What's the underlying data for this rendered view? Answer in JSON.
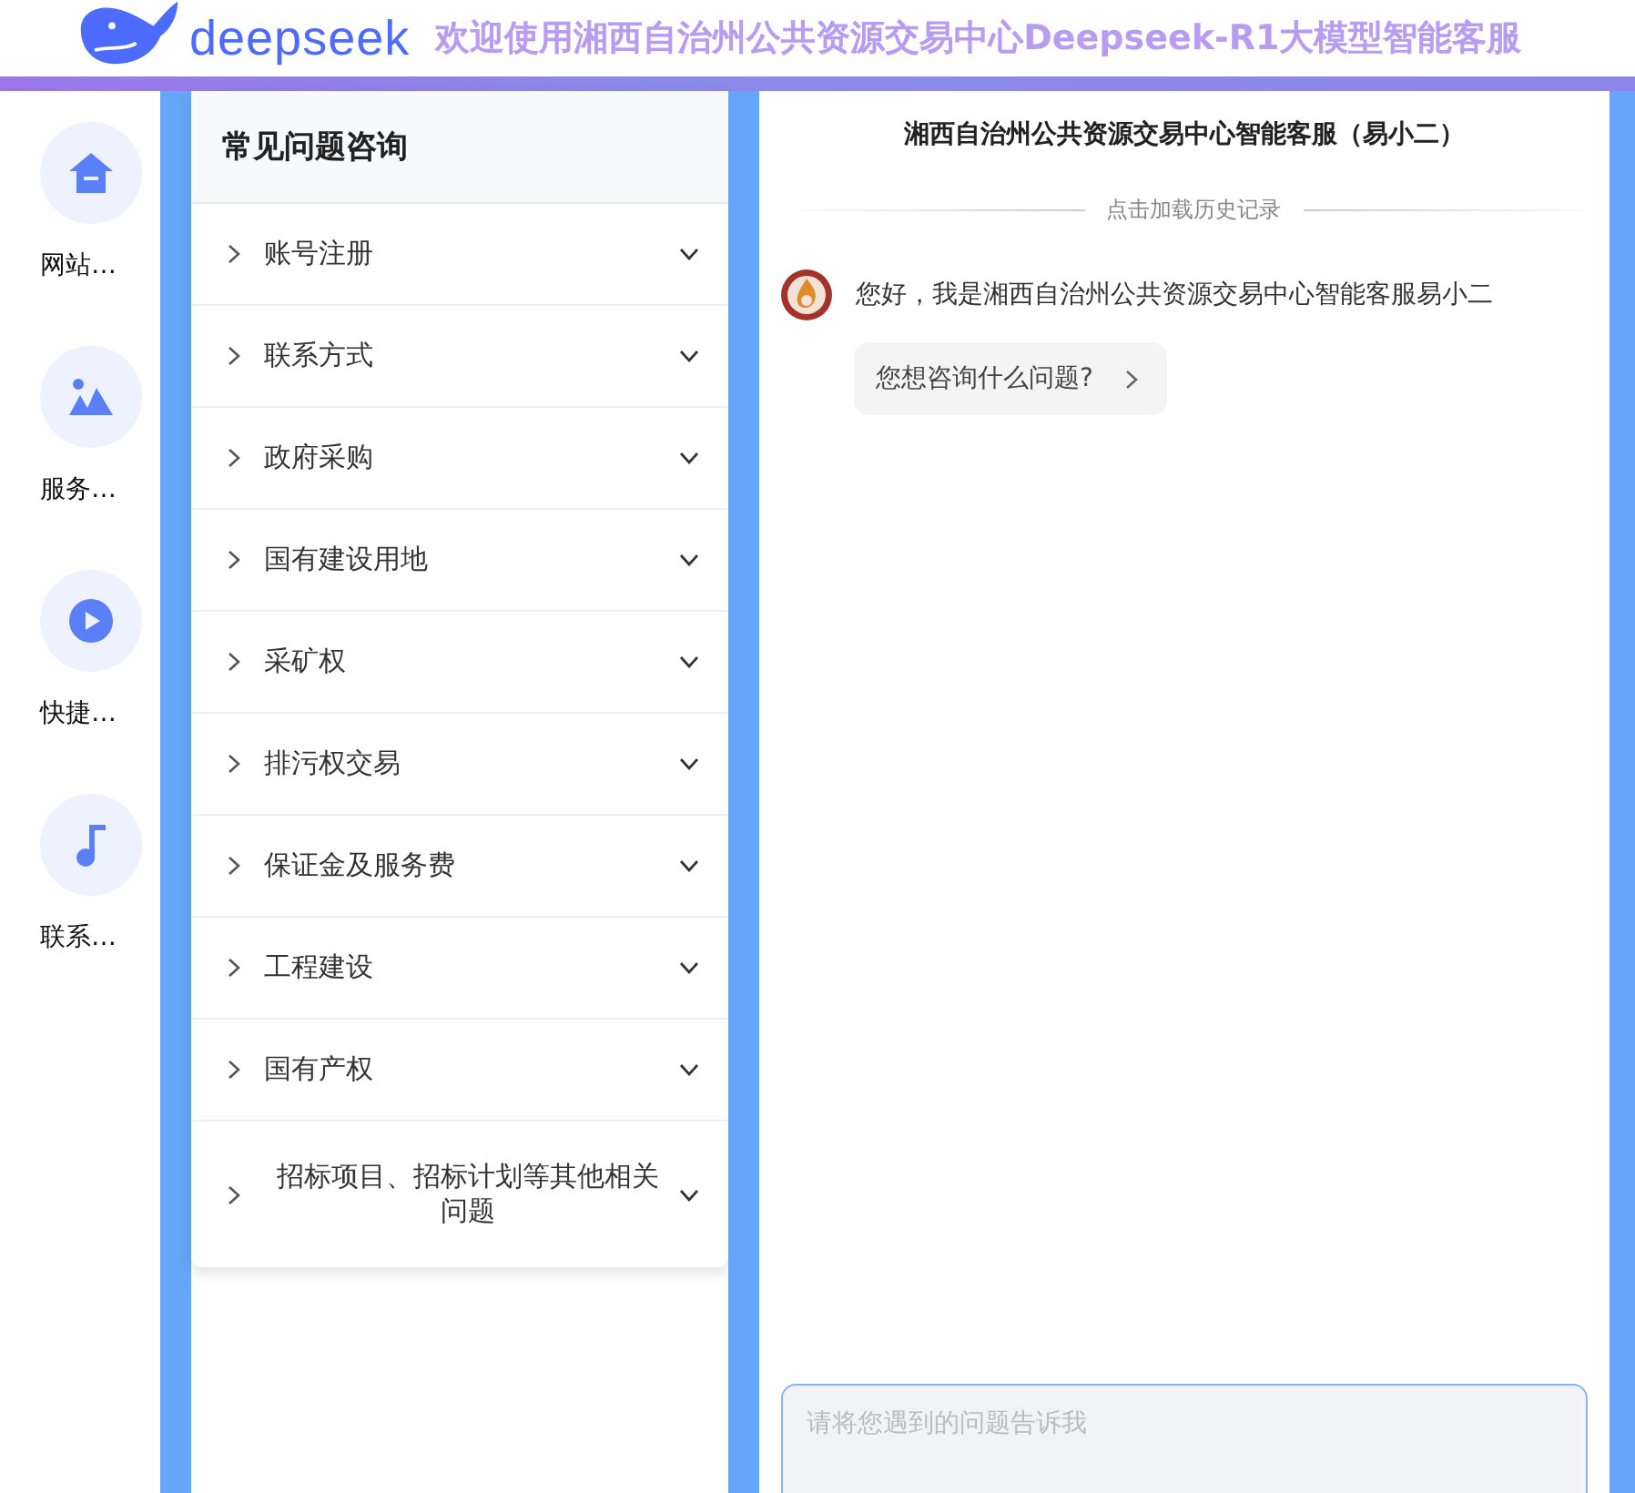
{
  "header": {
    "logo_text": "deepseek",
    "title": "欢迎使用湘西自治州公共资源交易中心Deepseek-R1大模型智能客服"
  },
  "sidebar": {
    "items": [
      {
        "kind": "home",
        "label": "网站…"
      },
      {
        "kind": "image",
        "label": "服务…"
      },
      {
        "kind": "play",
        "label": "快捷…"
      },
      {
        "kind": "music",
        "label": "联系…"
      }
    ]
  },
  "faq": {
    "title": "常见问题咨询",
    "items": [
      {
        "label": "账号注册",
        "expanded": false
      },
      {
        "label": "联系方式",
        "expanded": false
      },
      {
        "label": "政府采购",
        "expanded": false
      },
      {
        "label": "国有建设用地",
        "expanded": false
      },
      {
        "label": "采矿权",
        "expanded": false
      },
      {
        "label": "排污权交易",
        "expanded": false
      },
      {
        "label": "保证金及服务费",
        "expanded": false
      },
      {
        "label": "工程建设",
        "expanded": false
      },
      {
        "label": "国有产权",
        "expanded": false
      },
      {
        "label": "招标项目、招标计划等其他相关问题",
        "expanded": false
      }
    ]
  },
  "chat": {
    "title": "湘西自治州公共资源交易中心智能客服（易小二）",
    "history_link": "点击加载历史记录",
    "messages": [
      {
        "text": "您好，我是湘西自治州公共资源交易中心智能客服易小二",
        "suggestion": "您想咨询什么问题?"
      }
    ],
    "input": {
      "placeholder": "请将您遇到的问题告诉我"
    }
  }
}
